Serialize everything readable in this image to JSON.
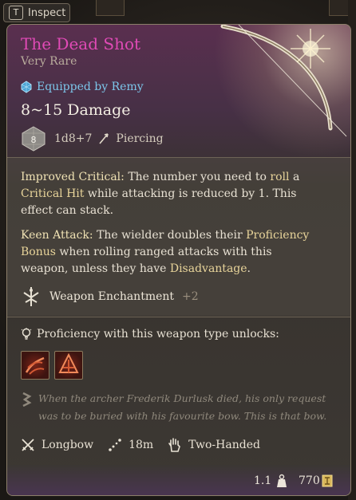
{
  "inspect": {
    "key": "T",
    "label": "Inspect"
  },
  "item": {
    "name": "The Dead Shot",
    "rarity": "Very Rare",
    "equipped_by": "Equipped by Remy",
    "damage": "8~15 Damage",
    "dice_value": "8",
    "dice_roll": "1d8+7",
    "damage_type": "Piercing"
  },
  "passives": [
    {
      "name": "Improved Critical:",
      "t1": " The number you need to ",
      "k1": "roll",
      "t2": " a ",
      "k2": "Critical Hit",
      "t3": " while attacking is reduced by 1. This effect can stack."
    },
    {
      "name": "Keen Attack:",
      "t1": " The wielder doubles their ",
      "k1": "Proficiency Bonus",
      "t2": " when rolling ranged attacks with this weapon, unless they have ",
      "k2": "Disadvantage",
      "t3": "."
    }
  ],
  "enchantment": {
    "label": "Weapon Enchantment",
    "bonus": "+2"
  },
  "proficiency": {
    "label": "Proficiency with this weapon type unlocks:"
  },
  "flavor_text": "When the archer Frederik Durlusk died, his only request was to be buried with his favourite bow. This is that bow.",
  "properties": {
    "type": "Longbow",
    "range": "18m",
    "handedness": "Two-Handed"
  },
  "footer": {
    "weight": "1.1",
    "price": "770"
  },
  "colors": {
    "title": "#e04ab6",
    "equipped": "#7cc6ea",
    "keyword": "#e8d49a",
    "rarity_tint": "#5a2f4f"
  },
  "icons": {
    "equipped": "gem-icon",
    "dice": "d8-die-icon",
    "damage_type": "arrow-icon",
    "enchantment": "enchantment-sigil-icon",
    "proficiency": "lightbulb-icon",
    "actions": [
      "piercing-shot-icon",
      "mobile-shot-icon"
    ],
    "flavor": "scroll-icon",
    "weapon_type": "crossed-swords-icon",
    "range": "range-dots-icon",
    "hands": "hand-icon",
    "weight": "weight-icon",
    "price": "gold-icon"
  }
}
